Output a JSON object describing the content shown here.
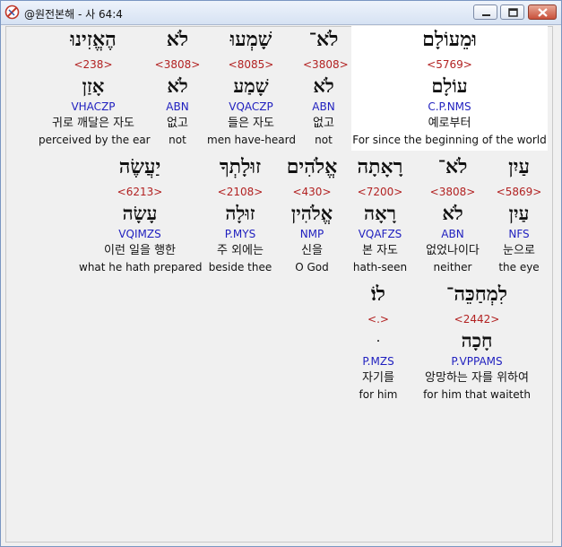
{
  "window": {
    "title": "@원전본해 - 사 64:4",
    "buttons": {
      "minimize": "minimize",
      "maximize": "maximize",
      "close": "close"
    }
  },
  "rows": [
    [
      {
        "heb": "וּמֵעוֹלָם",
        "strong": "<5769>",
        "lemma": "עוֹלָם",
        "morph": "C.P.NMS",
        "kor": "예로부터",
        "eng": "For since the beginning of the world"
      },
      {
        "heb": "לֹא־",
        "strong": "<3808>",
        "lemma": "לֹא",
        "morph": "ABN",
        "kor": "없고",
        "eng": "not"
      },
      {
        "heb": "שָׁמְעוּ",
        "strong": "<8085>",
        "lemma": "שָׁמַע",
        "morph": "VQACZP",
        "kor": "들은 자도",
        "eng": "men have-heard"
      },
      {
        "heb": "לֹא",
        "strong": "<3808>",
        "lemma": "לֹא",
        "morph": "ABN",
        "kor": "없고",
        "eng": "not"
      },
      {
        "heb": "הֶאֱזִינוּ",
        "strong": "<238>",
        "lemma": "אָזַן",
        "morph": "VHACZP",
        "kor": "귀로 깨달은 자도",
        "eng": "perceived by the ear"
      }
    ],
    [
      {
        "heb": "עַיִן",
        "strong": "<5869>",
        "lemma": "עַיִן",
        "morph": "NFS",
        "kor": "눈으로",
        "eng": "the eye"
      },
      {
        "heb": "לֹא־",
        "strong": "<3808>",
        "lemma": "לֹא",
        "morph": "ABN",
        "kor": "없었나이다",
        "eng": "neither"
      },
      {
        "heb": "רָאָתָה",
        "strong": "<7200>",
        "lemma": "רָאָה",
        "morph": "VQAFZS",
        "kor": "본 자도",
        "eng": "hath-seen"
      },
      {
        "heb": "אֱלֹהִים",
        "strong": "<430>",
        "lemma": "אֱלֹהִין",
        "morph": "NMP",
        "kor": "신을",
        "eng": "O God"
      },
      {
        "heb": "זוּלָתְךָ",
        "strong": "<2108>",
        "lemma": "זוּלָה",
        "morph": "P.MYS",
        "kor": "주 외에는",
        "eng": "beside thee"
      },
      {
        "heb": "יַעֲשֶׂה",
        "strong": "<6213>",
        "lemma": "עָשָׂה",
        "morph": "VQIMZS",
        "kor": "이런 일을 행한",
        "eng": "what he hath prepared"
      }
    ],
    [
      {
        "heb": "לִמְחַכֵּה־",
        "strong": "<2442>",
        "lemma": "חָכָה",
        "morph": "P.VPPAMS",
        "kor": "앙망하는 자를 위하여",
        "eng": "for him that waiteth"
      },
      {
        "heb": "לוֹ׃",
        "strong": "<.>",
        "lemma": "ּ",
        "morph": "P.MZS",
        "kor": "자기를",
        "eng": "for him"
      }
    ]
  ]
}
